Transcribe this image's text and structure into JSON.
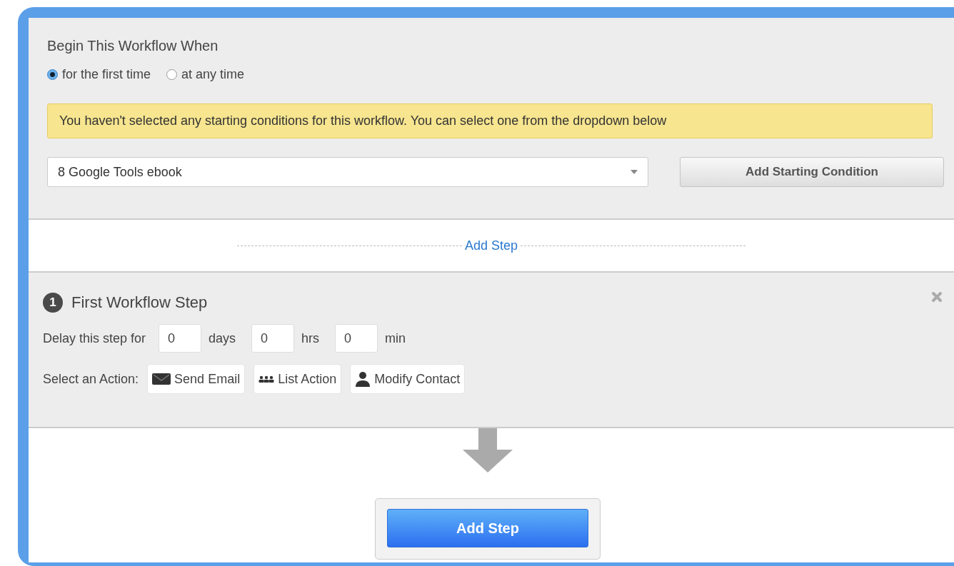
{
  "trigger": {
    "title": "Begin This Workflow When",
    "options": [
      {
        "label": "for the first time",
        "selected": true
      },
      {
        "label": "at any time",
        "selected": false
      }
    ],
    "notice": "You haven't selected any starting conditions for this workflow. You can select one from the dropdown below",
    "dropdown": {
      "value": "8 Google Tools ebook"
    },
    "button": "Add Starting Condition"
  },
  "add_step_link": "Add Step",
  "step": {
    "number": "1",
    "title": "First Workflow Step",
    "delay_label": "Delay this step for",
    "delays": [
      {
        "value": "0",
        "unit": "days"
      },
      {
        "value": "0",
        "unit": "hrs"
      },
      {
        "value": "0",
        "unit": "min"
      }
    ],
    "action_label": "Select an Action:",
    "actions": [
      {
        "label": "Send Email",
        "kind": "email"
      },
      {
        "label": "List Action",
        "kind": "list"
      },
      {
        "label": "Modify Contact",
        "kind": "contact"
      }
    ]
  },
  "add_step_button": "Add Step"
}
